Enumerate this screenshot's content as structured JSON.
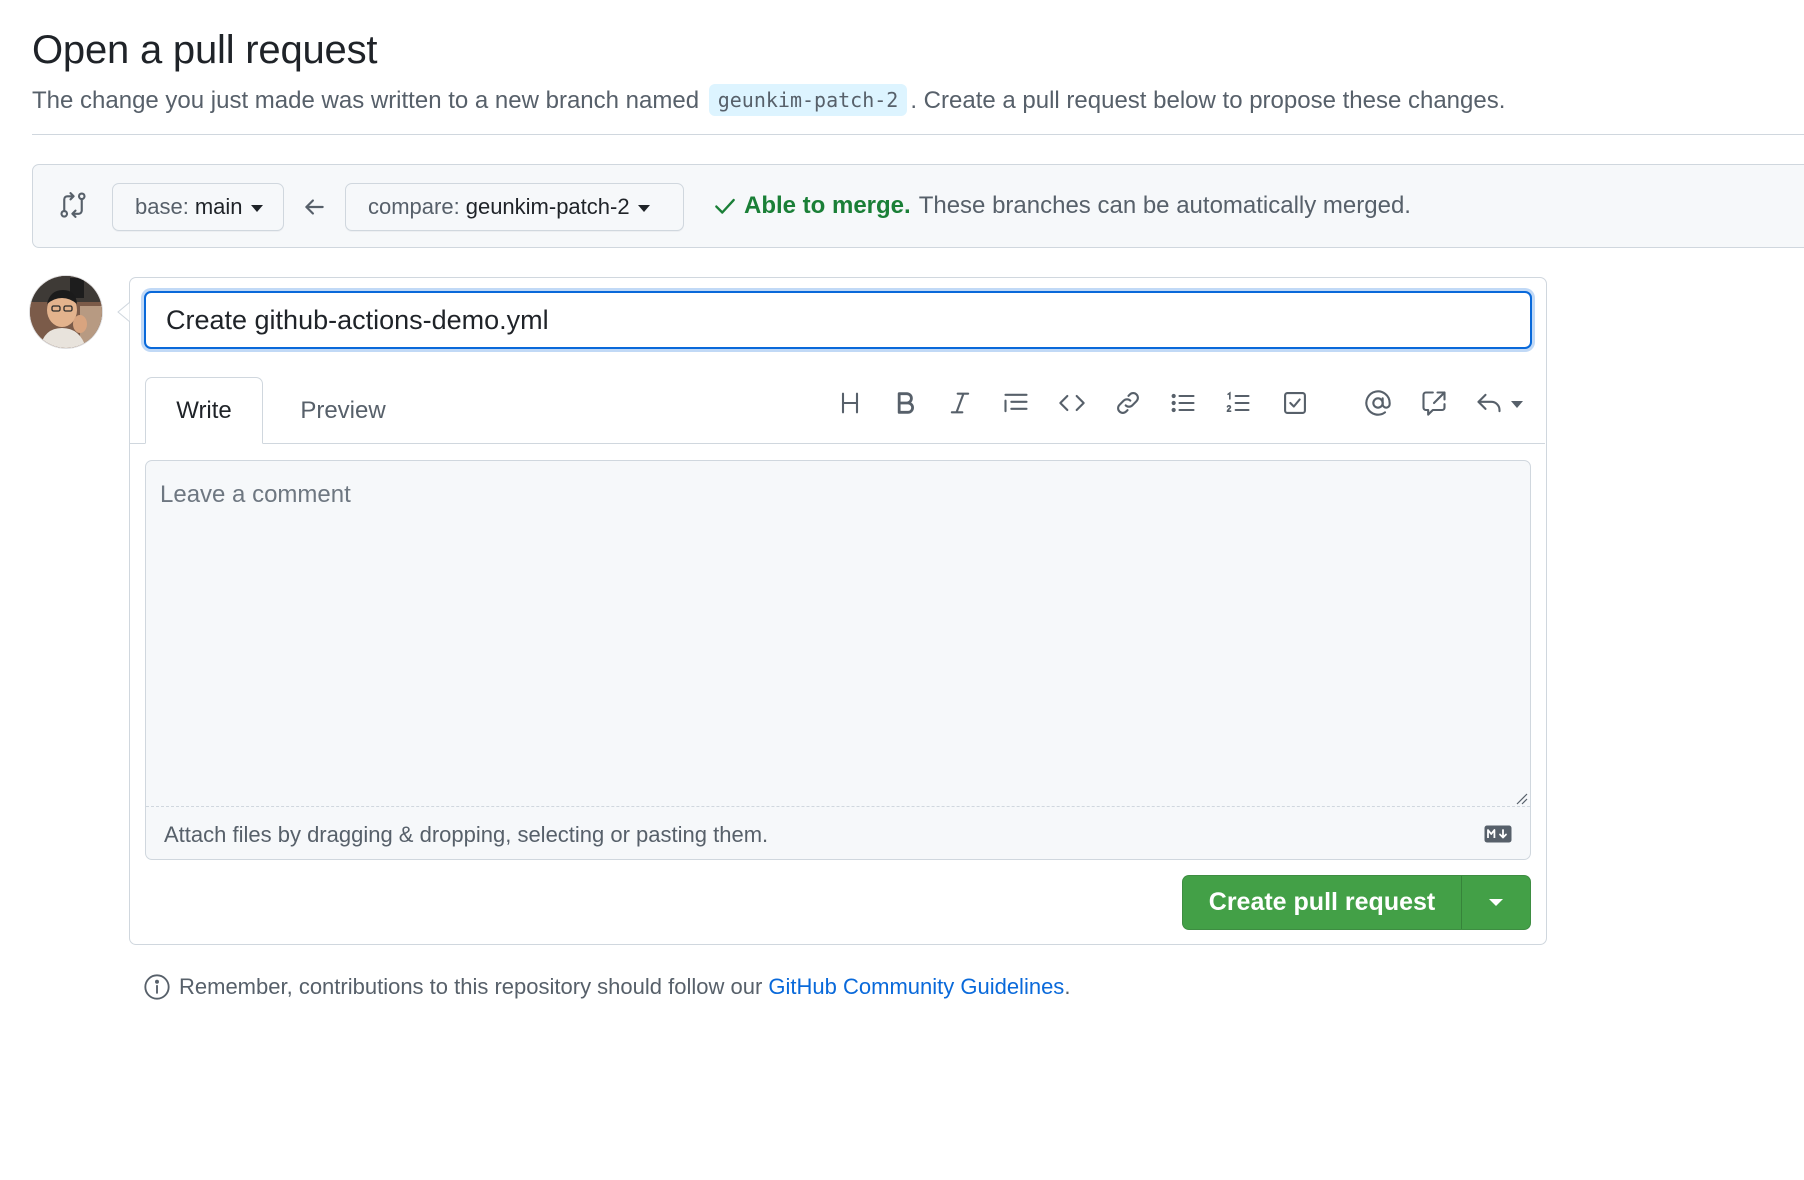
{
  "page": {
    "title": "Open a pull request",
    "subtitle_before": "The change you just made was written to a new branch named",
    "branch_name": "geunkim-patch-2",
    "subtitle_after": ". Create a pull request below to propose these changes."
  },
  "compare_bar": {
    "base_label": "base:",
    "base_branch": "main",
    "compare_label": "compare:",
    "compare_branch": "geunkim-patch-2",
    "merge_ok": "Able to merge.",
    "merge_detail": "These branches can be automatically merged."
  },
  "form": {
    "title_value": "Create github-actions-demo.yml",
    "tabs": [
      {
        "label": "Write",
        "active": true
      },
      {
        "label": "Preview",
        "active": false
      }
    ],
    "toolbar": [
      "heading-icon",
      "bold-icon",
      "italic-icon",
      "quote-icon",
      "code-icon",
      "link-icon",
      "unordered-list-icon",
      "ordered-list-icon",
      "task-list-icon",
      "mention-icon",
      "cross-reference-icon",
      "reply-icon"
    ],
    "comment_placeholder": "Leave a comment",
    "attach_text": "Attach files by dragging & dropping, selecting or pasting them.",
    "submit_label": "Create pull request"
  },
  "footer": {
    "note_before": "Remember, contributions to this repository should follow our",
    "link_text": "GitHub Community Guidelines",
    "note_after": "."
  },
  "colors": {
    "accent": "#0969da",
    "success": "#1a7f37",
    "button_green": "#43a047",
    "muted_text": "#57606a",
    "border": "#d0d7de"
  }
}
